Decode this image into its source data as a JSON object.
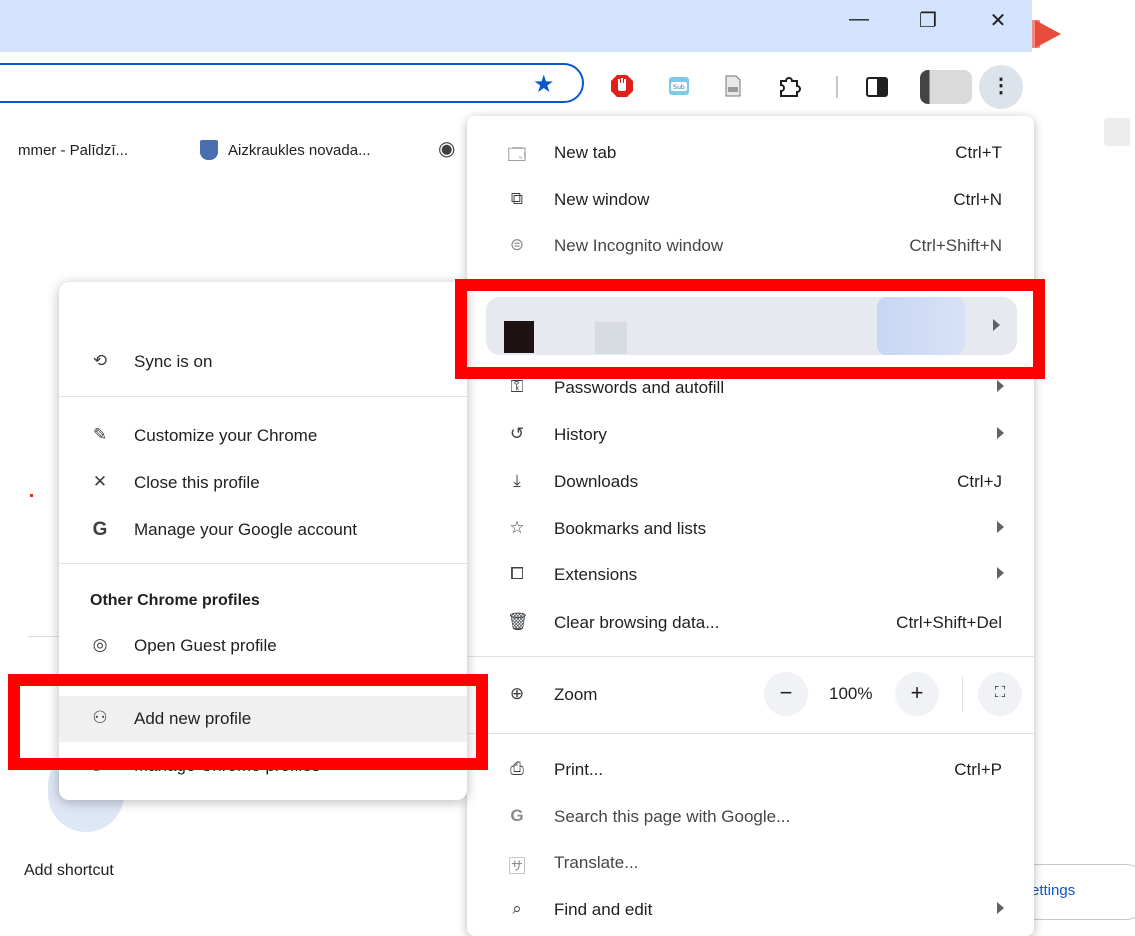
{
  "window": {
    "minimize": "—",
    "restore": "❐",
    "close": "✕"
  },
  "bookmarks": [
    {
      "label": "mmer - Palīdzī..."
    },
    {
      "label": "Aizkraukles novada..."
    }
  ],
  "menu": {
    "items": [
      {
        "label": "New tab",
        "shortcut": "Ctrl+T",
        "icon": "new-tab-icon"
      },
      {
        "label": "New window",
        "shortcut": "Ctrl+N",
        "icon": "new-window-icon"
      },
      {
        "label": "New Incognito window",
        "shortcut": "Ctrl+Shift+N",
        "icon": "incognito-icon"
      },
      {
        "label": "Passwords and autofill",
        "shortcut": "",
        "icon": "key-icon"
      },
      {
        "label": "History",
        "shortcut": "",
        "icon": "history-icon"
      },
      {
        "label": "Downloads",
        "shortcut": "Ctrl+J",
        "icon": "download-icon"
      },
      {
        "label": "Bookmarks and lists",
        "shortcut": "",
        "icon": "star-outline-icon"
      },
      {
        "label": "Extensions",
        "shortcut": "",
        "icon": "puzzle-icon"
      },
      {
        "label": "Clear browsing data...",
        "shortcut": "Ctrl+Shift+Del",
        "icon": "trash-icon"
      },
      {
        "label": "Zoom",
        "shortcut": "",
        "icon": "zoom-icon"
      },
      {
        "label": "Print...",
        "shortcut": "Ctrl+P",
        "icon": "print-icon"
      },
      {
        "label": "Search this page with Google...",
        "shortcut": "",
        "icon": "google-icon"
      },
      {
        "label": "Translate...",
        "shortcut": "",
        "icon": "translate-icon"
      },
      {
        "label": "Find and edit",
        "shortcut": "",
        "icon": "find-icon"
      }
    ],
    "zoom": {
      "value": "100%",
      "minus": "−",
      "plus": "+"
    }
  },
  "submenu": {
    "sync": "Sync is on",
    "items": [
      {
        "label": "Customize your Chrome"
      },
      {
        "label": "Close this profile"
      },
      {
        "label": "Manage your Google account"
      }
    ],
    "other_heading": "Other Chrome profiles",
    "guest": "Open Guest profile",
    "add_profile": "Add new profile",
    "manage_profiles": "Manage Chrome profiles"
  },
  "page": {
    "add_shortcut": "Add shortcut",
    "settings": "ettings"
  },
  "colors": {
    "titlebar": "#d3e3fd",
    "accent": "#0b57d0",
    "highlight": "#ff0000"
  }
}
